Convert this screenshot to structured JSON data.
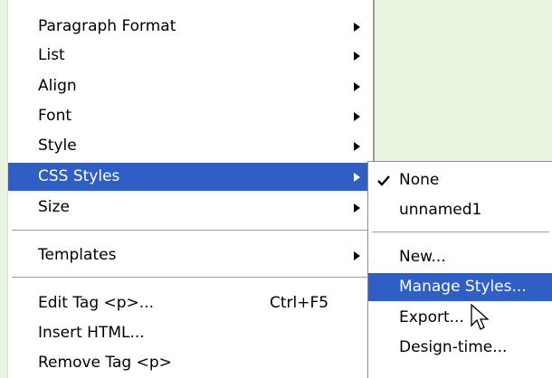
{
  "main_menu": {
    "items": [
      {
        "label": "Paragraph Format",
        "has_submenu": true
      },
      {
        "label": "List",
        "has_submenu": true
      },
      {
        "label": "Align",
        "has_submenu": true
      },
      {
        "label": "Font",
        "has_submenu": true
      },
      {
        "label": "Style",
        "has_submenu": true
      },
      {
        "label": "CSS Styles",
        "has_submenu": true,
        "highlighted": true
      },
      {
        "label": "Size",
        "has_submenu": true
      },
      {
        "label": "Templates",
        "has_submenu": true
      },
      {
        "label": "Edit Tag <p>...",
        "shortcut": "Ctrl+F5"
      },
      {
        "label": "Insert HTML..."
      },
      {
        "label": "Remove Tag <p>"
      }
    ]
  },
  "css_styles_submenu": {
    "items": [
      {
        "label": "None",
        "checked": true
      },
      {
        "label": "unnamed1"
      },
      {
        "label": "New..."
      },
      {
        "label": "Manage Styles...",
        "highlighted": true
      },
      {
        "label": "Export..."
      },
      {
        "label": "Design-time..."
      }
    ]
  },
  "colors": {
    "highlight": "#2f5fc4",
    "background": "#e6f4e0",
    "menu": "#ffffff"
  },
  "icons": {
    "submenu_arrow": "triangle-right-icon",
    "check": "checkmark-icon",
    "cursor": "mouse-pointer-icon"
  }
}
